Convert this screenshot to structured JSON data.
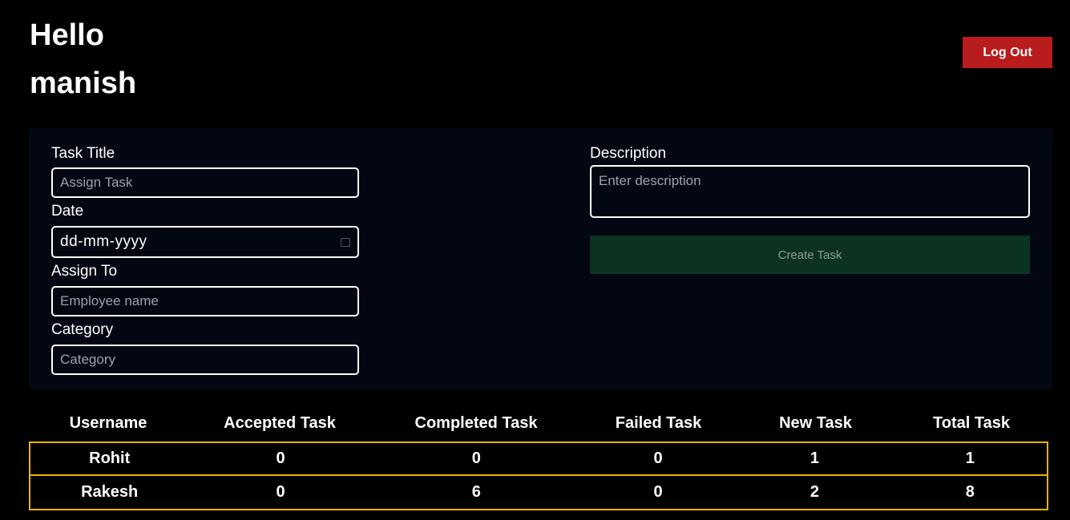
{
  "header": {
    "greeting_line1": "Hello",
    "greeting_line2": "manish",
    "logout_label": "Log Out"
  },
  "form": {
    "task_title": {
      "label": "Task Title",
      "placeholder": "Assign Task",
      "value": ""
    },
    "date": {
      "label": "Date",
      "display": "dd-mm-yyyy"
    },
    "assign_to": {
      "label": "Assign To",
      "placeholder": "Employee name",
      "value": ""
    },
    "category": {
      "label": "Category",
      "placeholder": "Category",
      "value": ""
    },
    "description": {
      "label": "Description",
      "placeholder": "Enter description",
      "value": ""
    },
    "create_label": "Create Task"
  },
  "stats": {
    "columns": [
      "Username",
      "Accepted Task",
      "Completed Task",
      "Failed Task",
      "New Task",
      "Total Task"
    ],
    "rows": [
      [
        "Rohit",
        "0",
        "0",
        "0",
        "1",
        "1"
      ],
      [
        "Rakesh",
        "0",
        "6",
        "0",
        "2",
        "8"
      ]
    ]
  },
  "colors": {
    "background": "#000000",
    "panel": "#030712",
    "logout": "#b91c1c",
    "create": "#0c3321",
    "row_border": "#eab308"
  },
  "icons": {
    "date_picker": "calendar-icon"
  }
}
